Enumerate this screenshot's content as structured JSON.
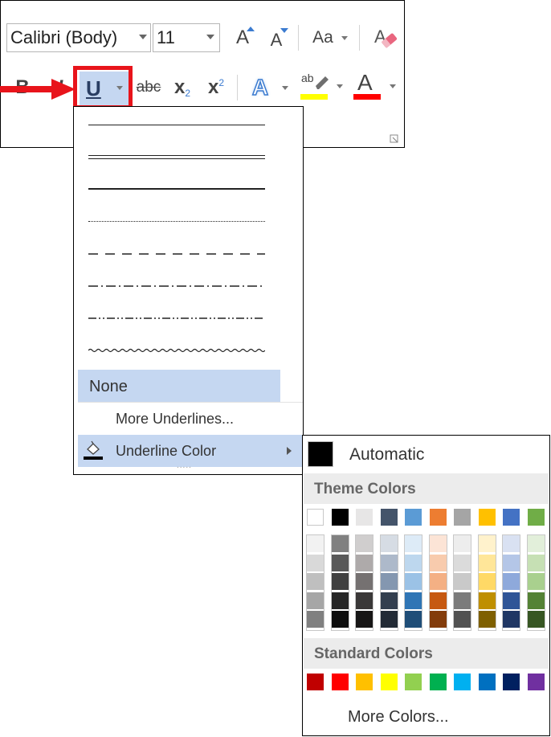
{
  "ribbon": {
    "font_name": "Calibri (Body)",
    "font_size": "11",
    "grow_font_label": "A",
    "shrink_font_label": "A",
    "change_case_label": "Aa",
    "bold_label": "B",
    "italic_label": "I",
    "underline_label": "U",
    "strikethrough_label": "abc",
    "subscript_label": "x",
    "subscript_small": "2",
    "superscript_label": "x",
    "superscript_small": "2",
    "text_effects_label": "A",
    "highlight_label": "ab",
    "font_color_label": "A"
  },
  "underline_menu": {
    "styles": [
      "single",
      "double",
      "thick",
      "dotted",
      "dashed",
      "dash-dot",
      "dash-dot-dot",
      "wave"
    ],
    "none_label": "None",
    "more_underlines_label": "More Underlines...",
    "underline_color_label": "Underline Color",
    "grip": "....."
  },
  "color_palette": {
    "automatic_label": "Automatic",
    "automatic_color": "#000000",
    "theme_colors_label": "Theme Colors",
    "standard_colors_label": "Standard Colors",
    "more_colors_label": "More Colors...",
    "theme_top": [
      "#FFFFFF",
      "#000000",
      "#E7E6E6",
      "#44546A",
      "#5B9BD5",
      "#ED7D31",
      "#A5A5A5",
      "#FFC000",
      "#4472C4",
      "#70AD47"
    ],
    "theme_shades": [
      [
        "#F2F2F2",
        "#D9D9D9",
        "#BFBFBF",
        "#A6A6A6",
        "#808080"
      ],
      [
        "#808080",
        "#595959",
        "#404040",
        "#262626",
        "#0D0D0D"
      ],
      [
        "#D0CECE",
        "#AEAAAA",
        "#757171",
        "#3A3838",
        "#171616"
      ],
      [
        "#D6DCE4",
        "#ADB9CA",
        "#8497B0",
        "#333F4F",
        "#222A35"
      ],
      [
        "#DDEBF7",
        "#BDD7EE",
        "#9BC2E6",
        "#2F75B5",
        "#1F4E78"
      ],
      [
        "#FCE4D6",
        "#F8CBAD",
        "#F4B084",
        "#C65911",
        "#833C0B"
      ],
      [
        "#EDEDED",
        "#DBDBDB",
        "#C9C9C9",
        "#7B7B7B",
        "#525252"
      ],
      [
        "#FFF2CC",
        "#FFE699",
        "#FFD966",
        "#BF8F00",
        "#7F6000"
      ],
      [
        "#D9E1F2",
        "#B4C6E7",
        "#8EA9DB",
        "#2F5597",
        "#203764"
      ],
      [
        "#E2EFDA",
        "#C6E0B4",
        "#A9D08E",
        "#548235",
        "#375623"
      ]
    ],
    "standard": [
      "#C00000",
      "#FF0000",
      "#FFC000",
      "#FFFF00",
      "#92D050",
      "#00B050",
      "#00B0F0",
      "#0070C0",
      "#002060",
      "#7030A0"
    ]
  },
  "accent": {
    "callout_red": "#E8141B",
    "highlight_yellow": "#FFFF00",
    "font_color_red": "#FF0000",
    "selected_blue": "#C5D7F1"
  }
}
